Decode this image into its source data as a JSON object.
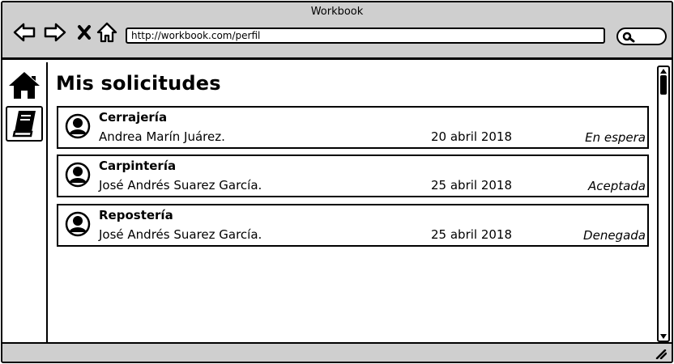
{
  "window": {
    "title": "Workbook"
  },
  "browser": {
    "url": "http://workbook.com/perfil",
    "icons": [
      "back-arrow-icon",
      "forward-arrow-icon",
      "close-x-icon",
      "home-outline-icon",
      "search-icon"
    ]
  },
  "sidebar": {
    "items": [
      {
        "icon": "home-icon",
        "active": false
      },
      {
        "icon": "book-icon",
        "active": true
      }
    ]
  },
  "main": {
    "title": "Mis solicitudes",
    "requests": [
      {
        "service": "Cerrajería",
        "person": "Andrea Marín Juárez.",
        "date": "20 abril 2018",
        "status": "En espera"
      },
      {
        "service": "Carpintería",
        "person": "José Andrés Suarez García.",
        "date": "25 abril 2018",
        "status": "Aceptada"
      },
      {
        "service": "Repostería",
        "person": "José Andrés Suarez García.",
        "date": "25 abril 2018",
        "status": "Denegada"
      }
    ]
  }
}
